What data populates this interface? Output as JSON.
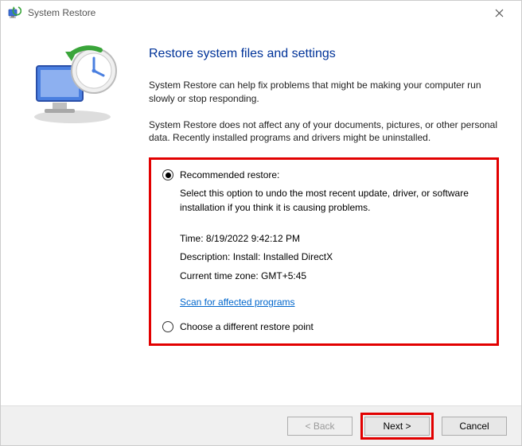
{
  "window": {
    "title": "System Restore",
    "close_icon": "close"
  },
  "page": {
    "heading": "Restore system files and settings",
    "intro1": "System Restore can help fix problems that might be making your computer run slowly or stop responding.",
    "intro2": "System Restore does not affect any of your documents, pictures, or other personal data. Recently installed programs and drivers might be uninstalled."
  },
  "options": {
    "recommended": {
      "label": "Recommended restore:",
      "description": "Select this option to undo the most recent update, driver, or software installation if you think it is causing problems.",
      "time_label": "Time: ",
      "time_value": "8/19/2022 9:42:12 PM",
      "desc_label": "Description: ",
      "desc_value": "Install: Installed DirectX",
      "tz_label": "Current time zone: ",
      "tz_value": "GMT+5:45",
      "scan_link": "Scan for affected programs",
      "selected": true
    },
    "different": {
      "label": "Choose a different restore point",
      "selected": false
    }
  },
  "buttons": {
    "back": "< Back",
    "next": "Next >",
    "cancel": "Cancel"
  }
}
